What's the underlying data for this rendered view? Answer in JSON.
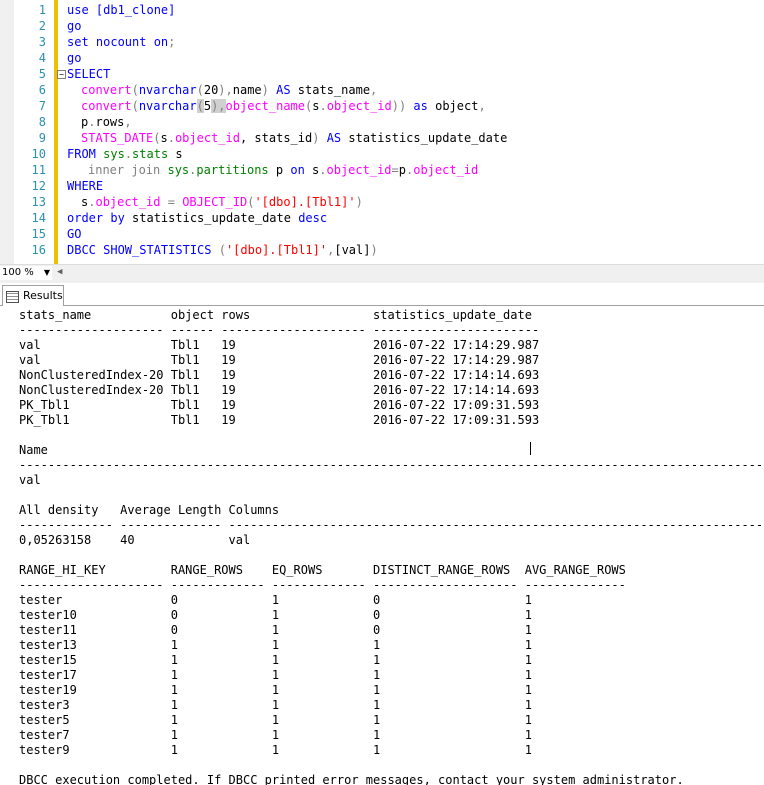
{
  "editor": {
    "line_numbers": [
      "1",
      "2",
      "3",
      "4",
      "5",
      "6",
      "7",
      "8",
      "9",
      "10",
      "11",
      "12",
      "13",
      "14",
      "15",
      "16"
    ],
    "fold_marker": "−"
  },
  "zoom": {
    "value": "100 %"
  },
  "tabs": {
    "results_label": "Results"
  },
  "results": {
    "lines": [
      "stats_name           object rows                 statistics_update_date",
      "-------------------- ------ -------------------- -----------------------",
      "val                  Tbl1   19                   2016-07-22 17:14:29.987",
      "val                  Tbl1   19                   2016-07-22 17:14:29.987",
      "NonClusteredIndex-20 Tbl1   19                   2016-07-22 17:14:14.693",
      "NonClusteredIndex-20 Tbl1   19                   2016-07-22 17:14:14.693",
      "PK_Tbl1              Tbl1   19                   2016-07-22 17:09:31.593",
      "PK_Tbl1              Tbl1   19                   2016-07-22 17:09:31.593",
      "",
      "Name",
      "--------------------------------------------------------------------------------------------------------------------------------",
      "val",
      "",
      "All density   Average Length Columns",
      "------------- -------------- --------------------------------------------------------------------------------------------------",
      "0,05263158    40             val",
      "",
      "RANGE_HI_KEY         RANGE_ROWS    EQ_ROWS       DISTINCT_RANGE_ROWS  AVG_RANGE_ROWS",
      "-------------------- ------------- ------------- -------------------- --------------",
      "tester               0             1             0                    1",
      "tester10             0             1             0                    1",
      "tester11             0             1             0                    1",
      "tester13             1             1             1                    1",
      "tester15             1             1             1                    1",
      "tester17             1             1             1                    1",
      "tester19             1             1             1                    1",
      "tester3              1             1             1                    1",
      "tester5              1             1             1                    1",
      "tester7              1             1             1                    1",
      "tester9              1             1             1                    1",
      "",
      "DBCC execution completed. If DBCC printed error messages, contact your system administrator."
    ]
  },
  "sql": {
    "l1": [
      "use [db1_clone]"
    ],
    "l2": [
      "go"
    ],
    "l3": [
      "set nocount on",
      ";"
    ],
    "l4": [
      "go"
    ],
    "l5": [
      "SELECT"
    ],
    "l6": [
      "convert",
      "(",
      "nvarchar",
      "(",
      "20",
      "),",
      "name",
      ")",
      " AS ",
      "stats_name",
      ","
    ],
    "l7": [
      "convert",
      "(",
      "nvarchar",
      "(",
      "5",
      "),",
      "object_name",
      "(",
      "s",
      ".",
      "object_id",
      "))",
      " as ",
      "object",
      ","
    ],
    "l8": [
      "p",
      ".",
      "rows",
      ","
    ],
    "l9": [
      "STATS_DATE",
      "(",
      "s",
      ".",
      "object_id",
      ", stats_id",
      ")",
      " AS ",
      "statistics_update_date"
    ],
    "l10": [
      "FROM ",
      "sys",
      ".",
      "stats",
      " s"
    ],
    "l11": [
      "inner join ",
      "sys",
      ".",
      "partitions",
      " p ",
      "on ",
      "s",
      ".",
      "object_id",
      "=",
      "p",
      ".",
      "object_id"
    ],
    "l12": [
      "WHERE"
    ],
    "l13": [
      "s",
      ".",
      "object_id",
      " = ",
      "OBJECT_ID",
      "(",
      "'[dbo].[Tbl1]'",
      ")"
    ],
    "l14": [
      "order by ",
      "statistics_update_date ",
      "desc"
    ],
    "l15": [
      "GO"
    ],
    "l16": [
      "DBCC SHOW_STATISTICS ",
      "(",
      "'[dbo].[Tbl1]'",
      ",",
      "[val]",
      ")"
    ]
  }
}
